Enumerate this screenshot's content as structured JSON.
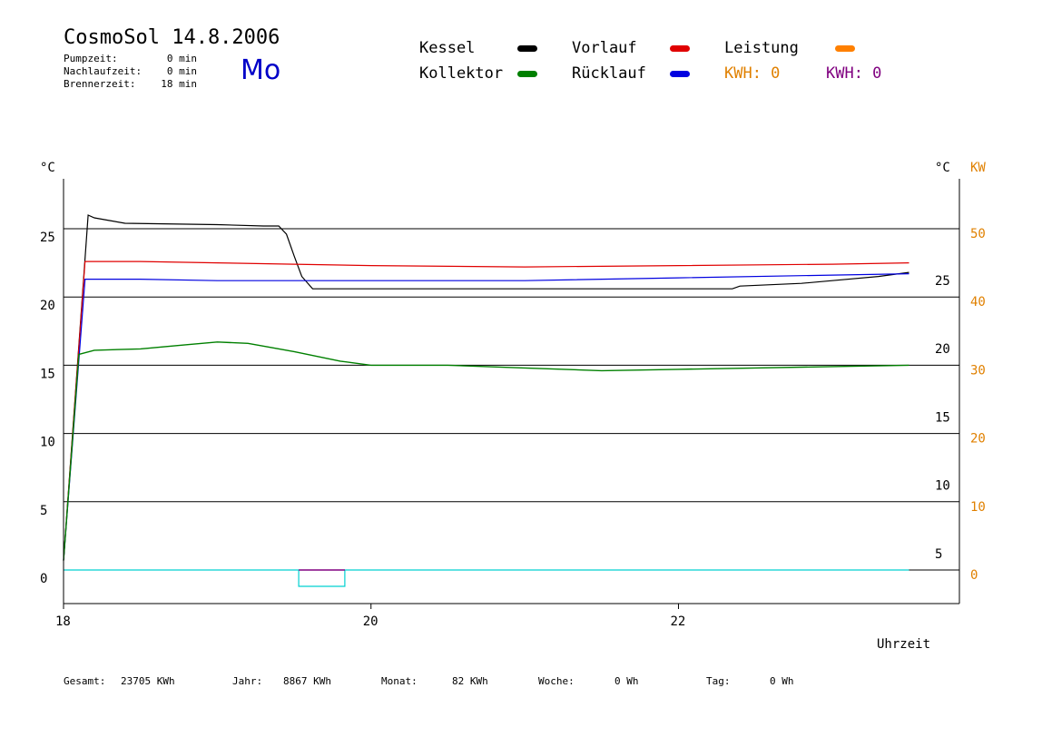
{
  "header": {
    "title": "CosmoSol 14.8.2006",
    "day": "Mo",
    "stats": [
      {
        "label": "Pumpzeit:",
        "value": "0 min"
      },
      {
        "label": "Nachlaufzeit:",
        "value": "0 min"
      },
      {
        "label": "Brennerzeit:",
        "value": "18 min"
      }
    ]
  },
  "legend": {
    "items": [
      {
        "label": "Kessel",
        "color": "#000000"
      },
      {
        "label": "Vorlauf",
        "color": "#e00000"
      },
      {
        "label": "Leistung",
        "color": "#ff8000"
      },
      {
        "label": "Kollektor",
        "color": "#008000"
      },
      {
        "label": "Rücklauf",
        "color": "#0000e0"
      }
    ],
    "kwh_orange": "KWH: 0",
    "kwh_purple": "KWH: 0"
  },
  "colors": {
    "kwh_orange": "#e08000",
    "kwh_purple": "#800080",
    "day": "#0000c8",
    "leistung_line": "#00d0d0"
  },
  "footer": [
    {
      "label": "Gesamt:",
      "value": "23705 KWh"
    },
    {
      "label": "Jahr:",
      "value": "8867 KWh"
    },
    {
      "label": "Monat:",
      "value": "82 KWh"
    },
    {
      "label": "Woche:",
      "value": "0 Wh"
    },
    {
      "label": "Tag:",
      "value": "0 Wh"
    }
  ],
  "chart_data": {
    "type": "line",
    "xlabel": "Uhrzeit",
    "ylabel_left": "°C",
    "ylabel_right": "°C",
    "ylabel_right2": "KW",
    "xlim": [
      18,
      23.55
    ],
    "ylim": [
      -1.7,
      27.6
    ],
    "xticks": [
      "18",
      "20",
      "22"
    ],
    "yticks_left": [
      "0",
      "5",
      "10",
      "15",
      "20",
      "25"
    ],
    "yticks_right": [
      "5",
      "10",
      "15",
      "20",
      "25"
    ],
    "yticks_right2": [
      "0",
      "10",
      "20",
      "30",
      "40",
      "50"
    ],
    "grid_y": [
      0,
      5,
      10,
      15,
      20,
      25
    ],
    "series": [
      {
        "name": "Kessel",
        "color": "#000000",
        "x": [
          18.0,
          18.16,
          18.2,
          18.3,
          18.4,
          19.0,
          19.3,
          19.4,
          19.45,
          19.5,
          19.55,
          19.62,
          20.0,
          21.0,
          22.0,
          22.35,
          22.4,
          22.8,
          23.0,
          23.3,
          23.5
        ],
        "y": [
          0.7,
          26.0,
          25.8,
          25.6,
          25.4,
          25.3,
          25.2,
          25.2,
          24.6,
          23.0,
          21.5,
          20.6,
          20.6,
          20.6,
          20.6,
          20.6,
          20.8,
          21.0,
          21.2,
          21.5,
          21.8
        ]
      },
      {
        "name": "Vorlauf",
        "color": "#e00000",
        "x": [
          18.0,
          18.14,
          18.2,
          18.5,
          19.0,
          19.5,
          20.0,
          21.0,
          22.0,
          23.0,
          23.5
        ],
        "y": [
          0.7,
          22.6,
          22.6,
          22.6,
          22.5,
          22.4,
          22.3,
          22.2,
          22.3,
          22.4,
          22.5
        ]
      },
      {
        "name": "Rücklauf",
        "color": "#0000e0",
        "x": [
          18.0,
          18.14,
          18.2,
          18.5,
          19.0,
          19.5,
          20.0,
          21.0,
          22.0,
          23.0,
          23.5
        ],
        "y": [
          0.7,
          21.3,
          21.3,
          21.3,
          21.2,
          21.2,
          21.2,
          21.2,
          21.4,
          21.6,
          21.7
        ]
      },
      {
        "name": "Kollektor",
        "color": "#008000",
        "x": [
          18.0,
          18.1,
          18.2,
          18.5,
          18.8,
          19.0,
          19.2,
          19.5,
          19.8,
          20.0,
          20.5,
          21.0,
          21.5,
          22.0,
          22.5,
          23.0,
          23.5
        ],
        "y": [
          0.7,
          15.8,
          16.1,
          16.2,
          16.5,
          16.7,
          16.6,
          16.0,
          15.3,
          15.0,
          15.0,
          14.8,
          14.6,
          14.7,
          14.8,
          14.9,
          15.0
        ]
      },
      {
        "name": "Leistung",
        "color": "#00d0d0",
        "x": [
          18.0,
          19.53,
          19.53,
          19.83,
          19.83,
          23.5
        ],
        "y": [
          0.0,
          0.0,
          -1.2,
          -1.2,
          0.0,
          0.0
        ]
      }
    ]
  }
}
